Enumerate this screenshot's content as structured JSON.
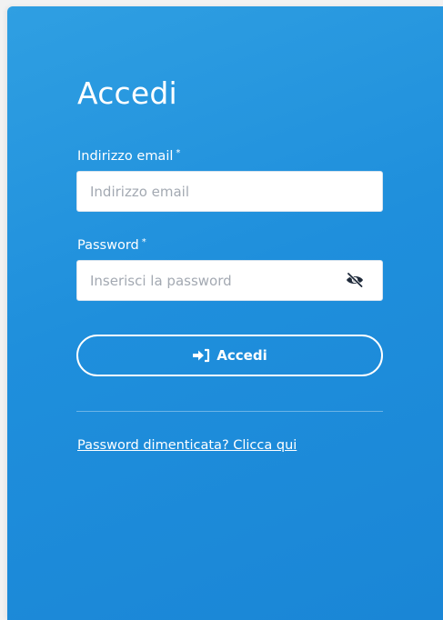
{
  "form": {
    "title": "Accedi",
    "email": {
      "label": "Indirizzo email",
      "required_mark": "*",
      "value": "",
      "placeholder": "Indirizzo email"
    },
    "password": {
      "label": "Password",
      "required_mark": "*",
      "value": "",
      "placeholder": "Inserisci la password",
      "toggle_icon": "eye-slash-icon"
    },
    "submit": {
      "label": "Accedi",
      "icon": "sign-in-icon"
    },
    "forgot_link": "Password dimenticata? Clicca qui"
  },
  "colors": {
    "panel_top": "#2f9fe2",
    "panel_bottom": "#1a86d6",
    "text": "#ffffff",
    "input_bg": "#ffffff",
    "placeholder": "#a3a9b2"
  }
}
